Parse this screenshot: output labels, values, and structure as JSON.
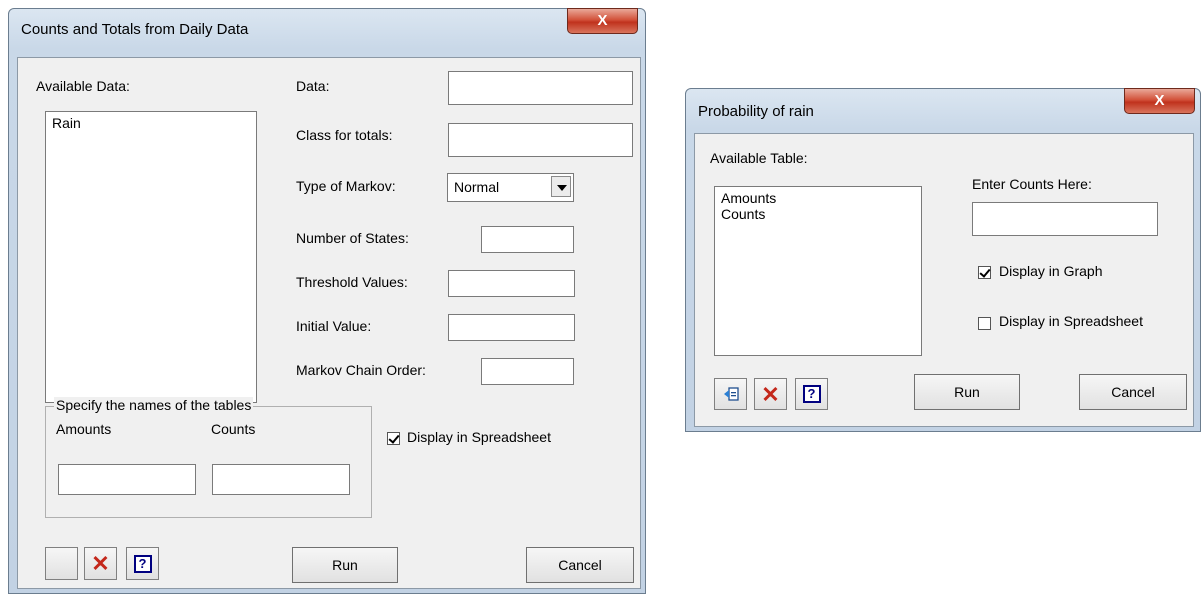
{
  "counts_dialog": {
    "title": "Counts and Totals from Daily Data",
    "close_label": "X",
    "available_data_label": "Available Data:",
    "available_data_items": [
      "Rain"
    ],
    "data_label": "Data:",
    "class_totals_label": "Class for totals:",
    "markov_type_label": "Type of Markov:",
    "markov_type_value": "Normal",
    "num_states_label": "Number of States:",
    "threshold_label": "Threshold Values:",
    "initial_value_label": "Initial Value:",
    "chain_order_label": "Markov Chain Order:",
    "group_legend": "Specify the names of the tables",
    "amounts_label": "Amounts",
    "counts_label": "Counts",
    "display_spreadsheet_label": "Display in Spreadsheet",
    "display_spreadsheet_checked": true,
    "run_label": "Run",
    "cancel_label": "Cancel",
    "help_label": "?"
  },
  "rain_dialog": {
    "title": "Probability of rain",
    "close_label": "X",
    "available_table_label": "Available Table:",
    "available_table_items": [
      "Amounts",
      "Counts"
    ],
    "enter_counts_label": "Enter Counts Here:",
    "display_graph_label": "Display in Graph",
    "display_graph_checked": true,
    "display_spreadsheet_label": "Display in Spreadsheet",
    "display_spreadsheet_checked": false,
    "run_label": "Run",
    "cancel_label": "Cancel",
    "help_label": "?"
  }
}
